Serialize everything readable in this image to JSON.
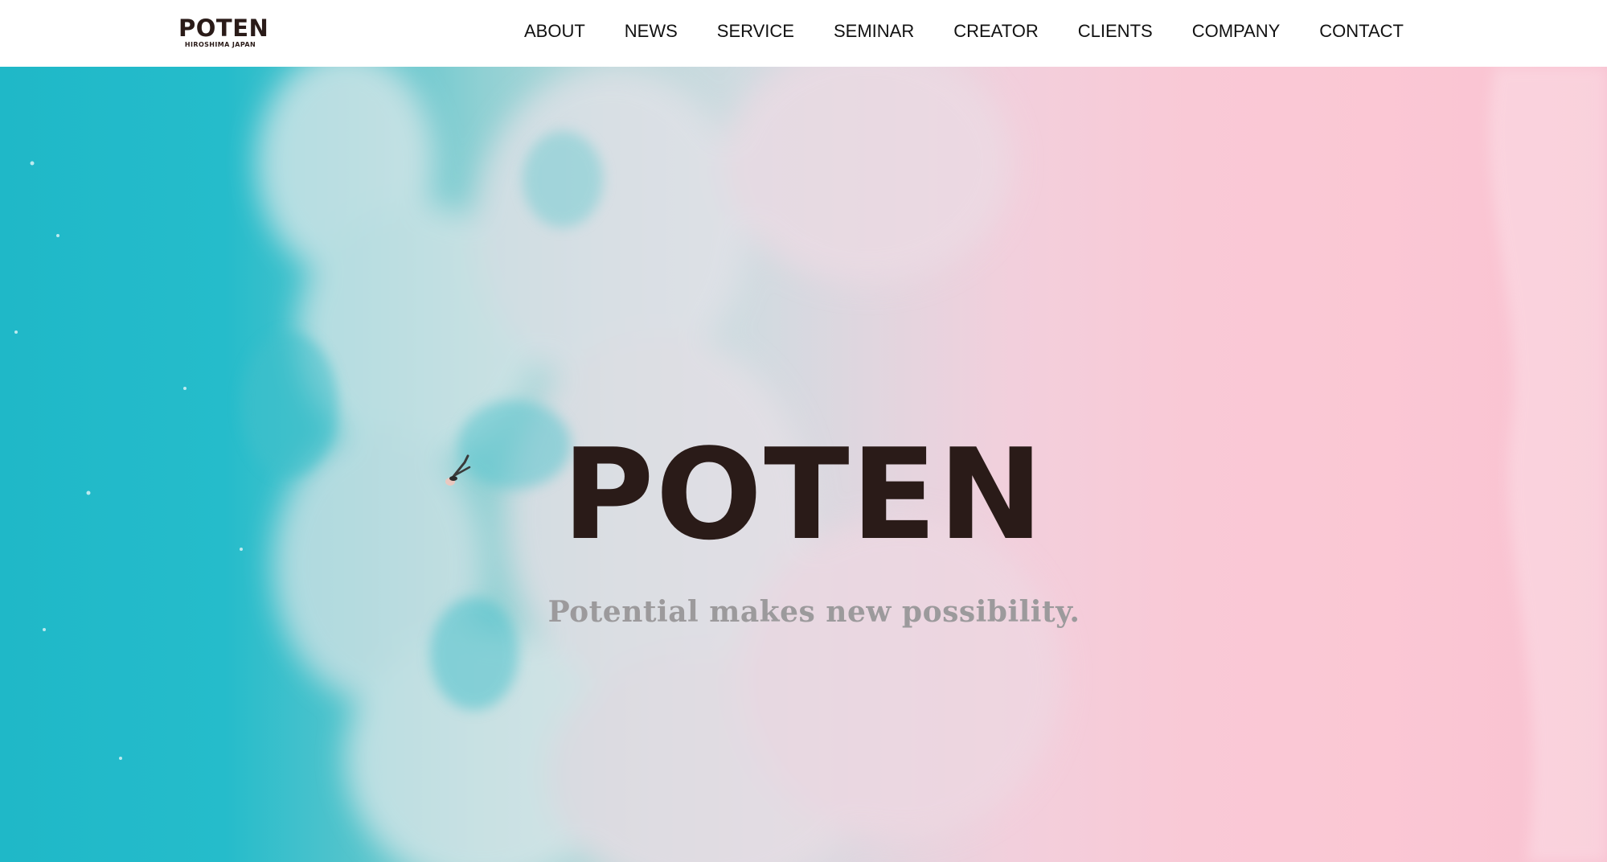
{
  "header": {
    "logo": {
      "name": "POTEN",
      "sub": "HIROSHIMA JAPAN"
    },
    "nav": [
      {
        "label": "ABOUT"
      },
      {
        "label": "NEWS"
      },
      {
        "label": "SERVICE"
      },
      {
        "label": "SEMINAR"
      },
      {
        "label": "CREATOR"
      },
      {
        "label": "CLIENTS"
      },
      {
        "label": "COMPANY"
      },
      {
        "label": "CONTACT"
      }
    ]
  },
  "hero": {
    "title": "POTEN",
    "tagline": "Potential makes new possibility.",
    "colors": {
      "sea": "#1fb8c8",
      "foam": "#d6dde2",
      "sand": "#f8c2d1",
      "title": "#2a1b18"
    }
  }
}
